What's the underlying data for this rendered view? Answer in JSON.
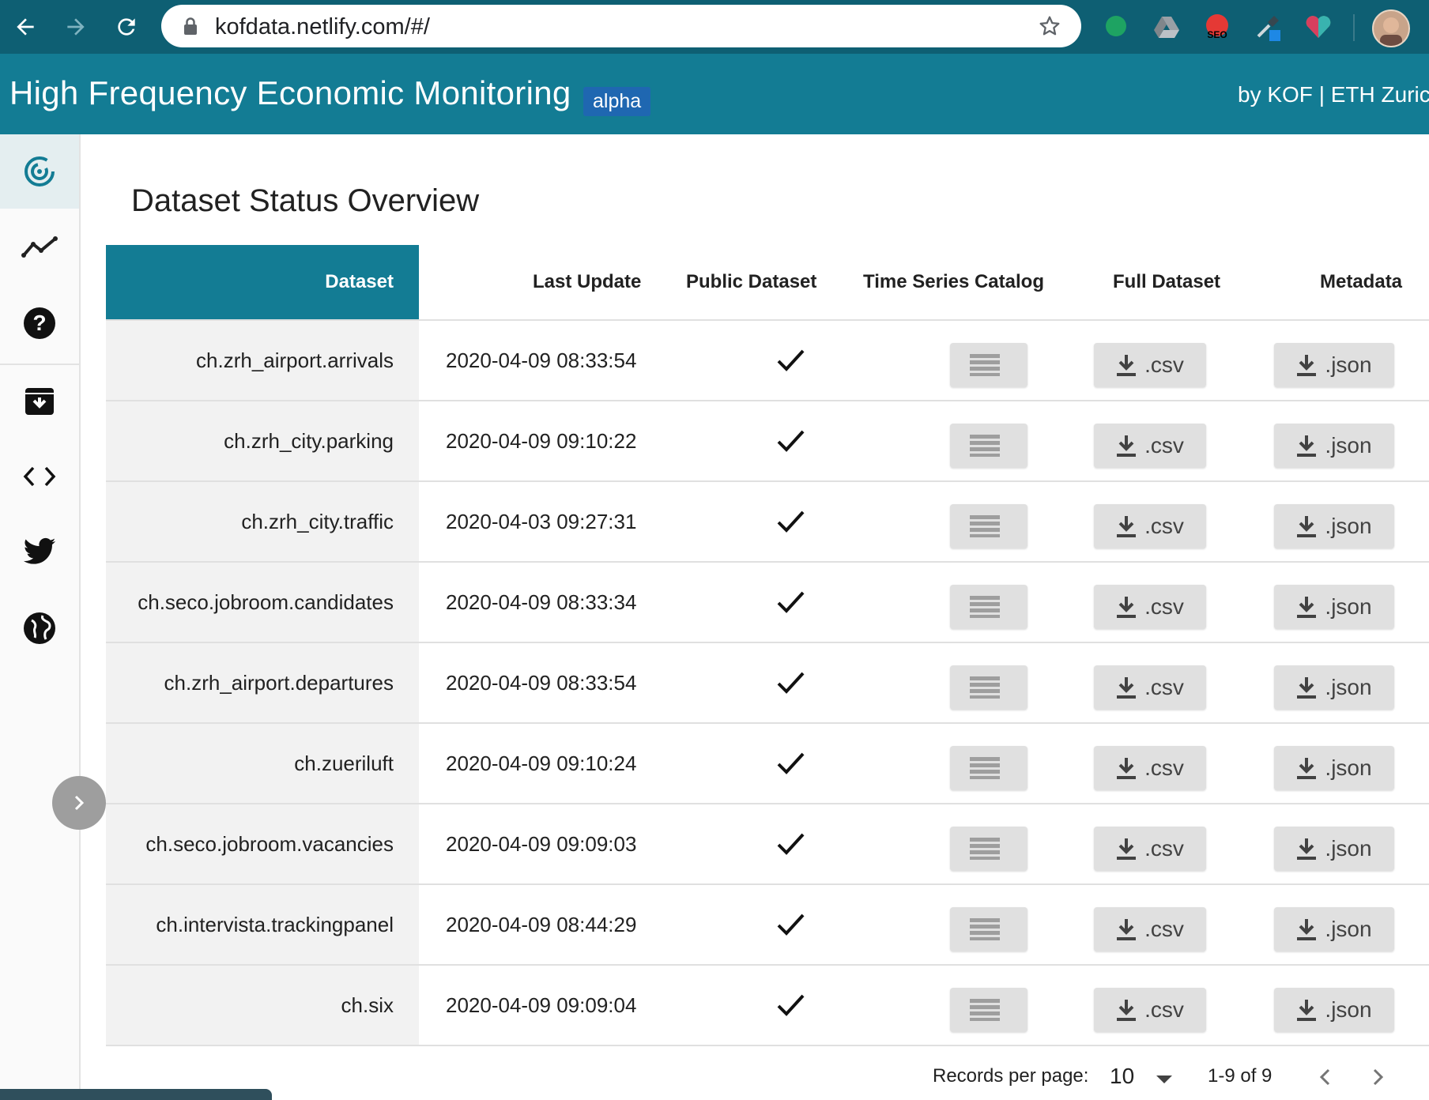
{
  "browser": {
    "url": "kofdata.netlify.com/#/"
  },
  "header": {
    "title": "High Frequency Economic Monitoring",
    "badge": "alpha",
    "byline": "by KOF | ETH Zurich"
  },
  "colors": {
    "header_bg": "#137c94",
    "browser_bar": "#0e5f73",
    "badge_bg": "#1f67b1",
    "button_bg": "#e0e0e0"
  },
  "sidebar": {
    "items": [
      {
        "icon": "dashboard-radar-icon",
        "active": true
      },
      {
        "icon": "trending-line-icon",
        "active": false
      },
      {
        "icon": "help-icon",
        "active": false
      },
      {
        "icon": "archive-download-icon",
        "active": false
      },
      {
        "icon": "code-icon",
        "active": false
      },
      {
        "icon": "twitter-icon",
        "active": false
      },
      {
        "icon": "globe-icon",
        "active": false
      }
    ]
  },
  "page": {
    "title": "Dataset Status Overview"
  },
  "table": {
    "headers": {
      "dataset": "Dataset",
      "last_update": "Last Update",
      "public": "Public Dataset",
      "catalog": "Time Series Catalog",
      "full": "Full Dataset",
      "metadata": "Metadata"
    },
    "csv_label": ".csv",
    "json_label": ".json",
    "rows": [
      {
        "name": "ch.zrh_airport.arrivals",
        "updated": "2020-04-09 08:33:54",
        "public": true
      },
      {
        "name": "ch.zrh_city.parking",
        "updated": "2020-04-09 09:10:22",
        "public": true
      },
      {
        "name": "ch.zrh_city.traffic",
        "updated": "2020-04-03 09:27:31",
        "public": true
      },
      {
        "name": "ch.seco.jobroom.candidates",
        "updated": "2020-04-09 08:33:34",
        "public": true
      },
      {
        "name": "ch.zrh_airport.departures",
        "updated": "2020-04-09 08:33:54",
        "public": true
      },
      {
        "name": "ch.zueriluft",
        "updated": "2020-04-09 09:10:24",
        "public": true
      },
      {
        "name": "ch.seco.jobroom.vacancies",
        "updated": "2020-04-09 09:09:03",
        "public": true
      },
      {
        "name": "ch.intervista.trackingpanel",
        "updated": "2020-04-09 08:44:29",
        "public": true
      },
      {
        "name": "ch.six",
        "updated": "2020-04-09 09:09:04",
        "public": true
      }
    ]
  },
  "pagination": {
    "rows_per_page_label": "Records per page:",
    "rows_per_page": "10",
    "range": "1-9 of 9"
  }
}
